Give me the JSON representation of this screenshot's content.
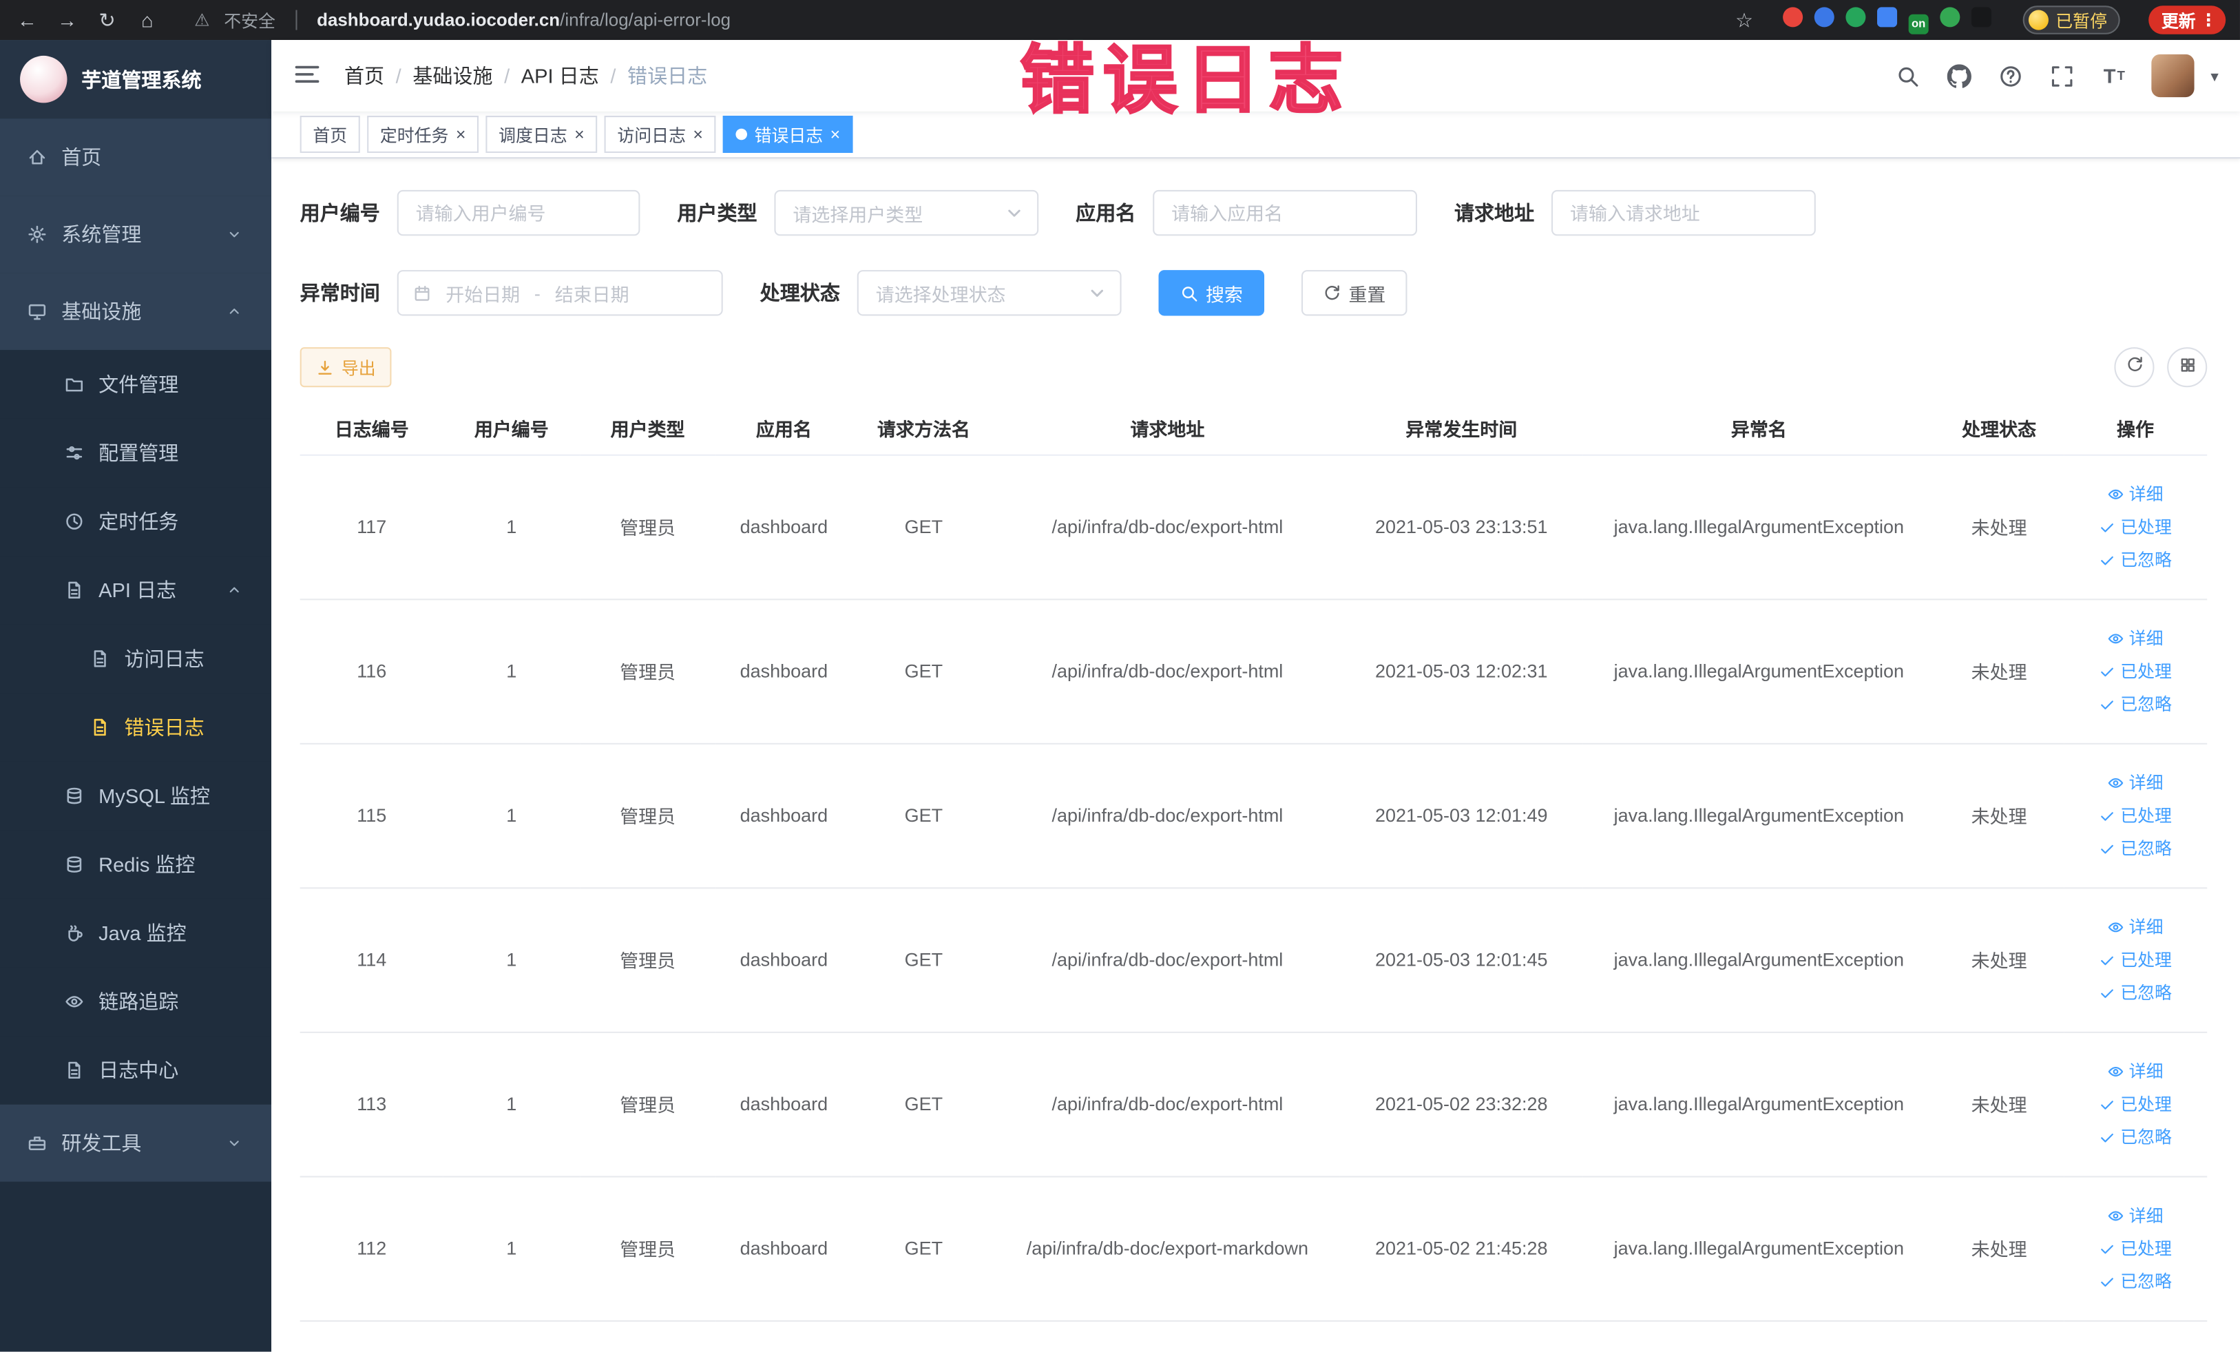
{
  "theme": {
    "accent": "#409eff",
    "sidebar_bg": "#304156",
    "submenu_bg": "#1f2d3d",
    "sidebar_text": "#bfcbd9",
    "active_text": "#ffd04b",
    "warning_text": "#e6a23c"
  },
  "browser": {
    "security_label": "不安全",
    "url_domain": "dashboard.yudao.iocoder.cn",
    "url_path": "/infra/log/api-error-log",
    "extensions": [
      {
        "name": "extension-icon-1",
        "color": "#e8453c",
        "shape": "circle",
        "label": ""
      },
      {
        "name": "extension-icon-2",
        "color": "#3b78e7",
        "shape": "circle",
        "label": ""
      },
      {
        "name": "extension-icon-3",
        "color": "#26a65b",
        "shape": "circle",
        "label": ""
      },
      {
        "name": "extension-icon-4",
        "color": "#4285f4",
        "shape": "square",
        "label": ""
      },
      {
        "name": "extension-icon-5",
        "color": "#1e8e3e",
        "shape": "square",
        "label": "on"
      },
      {
        "name": "extension-icon-6",
        "color": "#34a853",
        "shape": "circle",
        "label": ""
      },
      {
        "name": "extension-icon-7",
        "color": "#17181a",
        "shape": "square",
        "label": ""
      }
    ],
    "paused_badge": "已暂停",
    "update_button": "更新"
  },
  "annotation": {
    "text": "错误日志",
    "color": "#f0436d"
  },
  "sidebar": {
    "logo_title": "芋道管理系统",
    "items": [
      {
        "key": "home",
        "label": "首页",
        "icon": "home-icon",
        "type": "top"
      },
      {
        "key": "system",
        "label": "系统管理",
        "icon": "gear-icon",
        "type": "top",
        "chevron": "down"
      },
      {
        "key": "infra",
        "label": "基础设施",
        "icon": "infra-icon",
        "type": "top",
        "chevron": "up"
      },
      {
        "key": "file",
        "label": "文件管理",
        "icon": "folder-icon",
        "type": "sub"
      },
      {
        "key": "config",
        "label": "配置管理",
        "icon": "config-icon",
        "type": "sub"
      },
      {
        "key": "job",
        "label": "定时任务",
        "icon": "clock-icon",
        "type": "sub"
      },
      {
        "key": "api-log",
        "label": "API 日志",
        "icon": "doc-icon",
        "type": "sub",
        "chevron": "up"
      },
      {
        "key": "access-log",
        "label": "访问日志",
        "icon": "doc-icon",
        "type": "subsub"
      },
      {
        "key": "error-log",
        "label": "错误日志",
        "icon": "doc-icon",
        "type": "subsub",
        "active": true
      },
      {
        "key": "mysql",
        "label": "MySQL 监控",
        "icon": "db-icon",
        "type": "sub"
      },
      {
        "key": "redis",
        "label": "Redis 监控",
        "icon": "db-icon",
        "type": "sub"
      },
      {
        "key": "java",
        "label": "Java 监控",
        "icon": "java-icon",
        "type": "sub"
      },
      {
        "key": "trace",
        "label": "链路追踪",
        "icon": "eye-icon",
        "type": "sub"
      },
      {
        "key": "log-center",
        "label": "日志中心",
        "icon": "doc-icon",
        "type": "sub"
      },
      {
        "key": "dev-tools",
        "label": "研发工具",
        "icon": "toolbox-icon",
        "type": "top",
        "chevron": "down"
      }
    ]
  },
  "header": {
    "breadcrumb": [
      "首页",
      "基础设施",
      "API 日志",
      "错误日志"
    ]
  },
  "tabs": [
    {
      "key": "home",
      "label": "首页",
      "closable": false,
      "active": false
    },
    {
      "key": "job",
      "label": "定时任务",
      "closable": true,
      "active": false
    },
    {
      "key": "job-log",
      "label": "调度日志",
      "closable": true,
      "active": false
    },
    {
      "key": "access-log",
      "label": "访问日志",
      "closable": true,
      "active": false
    },
    {
      "key": "error-log",
      "label": "错误日志",
      "closable": true,
      "active": true
    }
  ],
  "filters": {
    "user_id": {
      "label": "用户编号",
      "placeholder": "请输入用户编号"
    },
    "user_type": {
      "label": "用户类型",
      "placeholder": "请选择用户类型"
    },
    "app_name": {
      "label": "应用名",
      "placeholder": "请输入应用名"
    },
    "request_url": {
      "label": "请求地址",
      "placeholder": "请输入请求地址"
    },
    "exception_time": {
      "label": "异常时间",
      "start_placeholder": "开始日期",
      "separator": "-",
      "end_placeholder": "结束日期"
    },
    "process_status": {
      "label": "处理状态",
      "placeholder": "请选择处理状态"
    },
    "search_button": "搜索",
    "reset_button": "重置"
  },
  "toolbar": {
    "export_button": "导出"
  },
  "table": {
    "columns": [
      "日志编号",
      "用户编号",
      "用户类型",
      "应用名",
      "请求方法名",
      "请求地址",
      "异常发生时间",
      "异常名",
      "处理状态",
      "操作"
    ],
    "actions": [
      "详细",
      "已处理",
      "已忽略"
    ],
    "rows": [
      {
        "id": "117",
        "user_id": "1",
        "user_type": "管理员",
        "app": "dashboard",
        "method": "GET",
        "url": "/api/infra/db-doc/export-html",
        "time": "2021-05-03 23:13:51",
        "exception": "java.lang.IllegalArgumentException",
        "status": "未处理"
      },
      {
        "id": "116",
        "user_id": "1",
        "user_type": "管理员",
        "app": "dashboard",
        "method": "GET",
        "url": "/api/infra/db-doc/export-html",
        "time": "2021-05-03 12:02:31",
        "exception": "java.lang.IllegalArgumentException",
        "status": "未处理"
      },
      {
        "id": "115",
        "user_id": "1",
        "user_type": "管理员",
        "app": "dashboard",
        "method": "GET",
        "url": "/api/infra/db-doc/export-html",
        "time": "2021-05-03 12:01:49",
        "exception": "java.lang.IllegalArgumentException",
        "status": "未处理"
      },
      {
        "id": "114",
        "user_id": "1",
        "user_type": "管理员",
        "app": "dashboard",
        "method": "GET",
        "url": "/api/infra/db-doc/export-html",
        "time": "2021-05-03 12:01:45",
        "exception": "java.lang.IllegalArgumentException",
        "status": "未处理"
      },
      {
        "id": "113",
        "user_id": "1",
        "user_type": "管理员",
        "app": "dashboard",
        "method": "GET",
        "url": "/api/infra/db-doc/export-html",
        "time": "2021-05-02 23:32:28",
        "exception": "java.lang.IllegalArgumentException",
        "status": "未处理"
      },
      {
        "id": "112",
        "user_id": "1",
        "user_type": "管理员",
        "app": "dashboard",
        "method": "GET",
        "url": "/api/infra/db-doc/export-markdown",
        "time": "2021-05-02 21:45:28",
        "exception": "java.lang.IllegalArgumentException",
        "status": "未处理"
      }
    ]
  }
}
